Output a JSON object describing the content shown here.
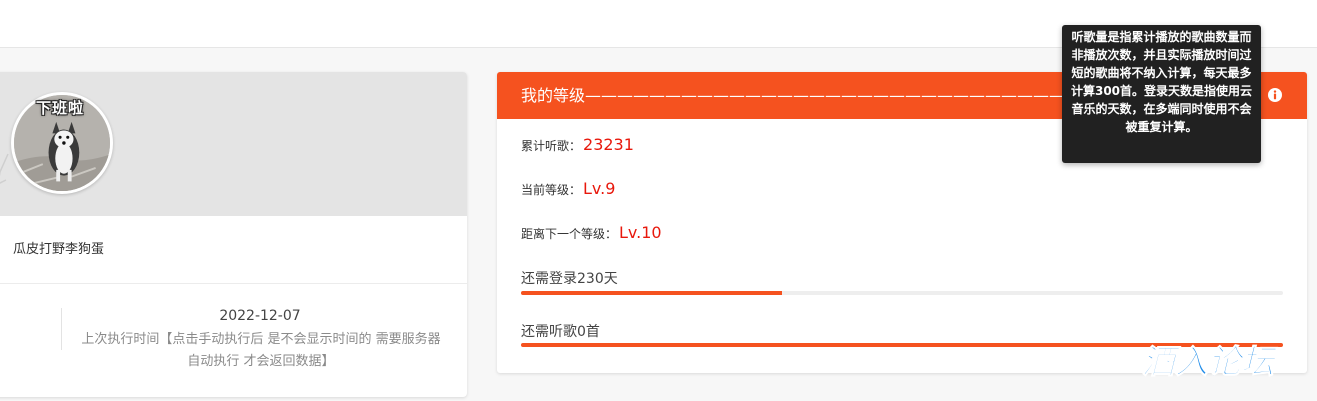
{
  "profile": {
    "avatar_caption": "下班啦",
    "nickname": "瓜皮打野李狗蛋",
    "exec_date": "2022-12-07",
    "exec_note": "上次执行时间【点击手动执行后 是不会显示时间的 需要服务器自动执行 才会返回数据】"
  },
  "level": {
    "title": "我的等级——————————————————————————————鼠标往",
    "listen_label": "累计听歌：",
    "listen_value": "23231",
    "current_label": "当前等级：",
    "current_value": "Lv.9",
    "next_label": "距离下一个等级：",
    "next_value": "Lv.10",
    "progress": [
      {
        "label": "还需登录230天",
        "fraction": 0.342
      },
      {
        "label": "还需听歌0首",
        "fraction": 1.0
      }
    ]
  },
  "tooltip": {
    "text": "听歌量是指累计播放的歌曲数量而非播放次数，并且实际播放时间过短的歌曲将不纳入计算，每天最多计算300首。登录天数是指使用云音乐的天数，在多端同时使用不会被重复计算。"
  },
  "watermark": {
    "text": "酒入论坛"
  },
  "colors": {
    "accent": "#f5521f",
    "value_red": "#e8180c",
    "tooltip_bg": "#212121",
    "watermark": "#1f8be8"
  },
  "icons": {
    "info": "info-circle-icon"
  }
}
